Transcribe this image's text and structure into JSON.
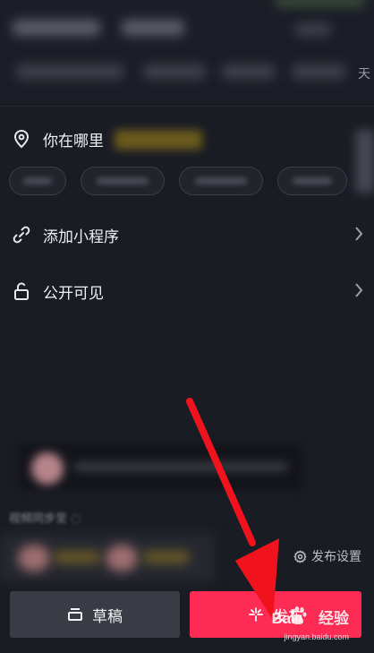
{
  "top": {
    "partial_text": "天"
  },
  "location": {
    "label": "你在哪里"
  },
  "mini_program": {
    "label": "添加小程序"
  },
  "visibility": {
    "label": "公开可见"
  },
  "sync": {
    "label": "视频同步至"
  },
  "publish_settings": {
    "label": "发布设置"
  },
  "buttons": {
    "draft": "草稿",
    "publish": "发布"
  },
  "watermark": {
    "brand": "Bai",
    "brand2": "经验",
    "url": "jingyan.baidu.com"
  },
  "colors": {
    "publish": "#fe2c55",
    "background": "#1a1c24",
    "arrow": "#f0131e"
  }
}
